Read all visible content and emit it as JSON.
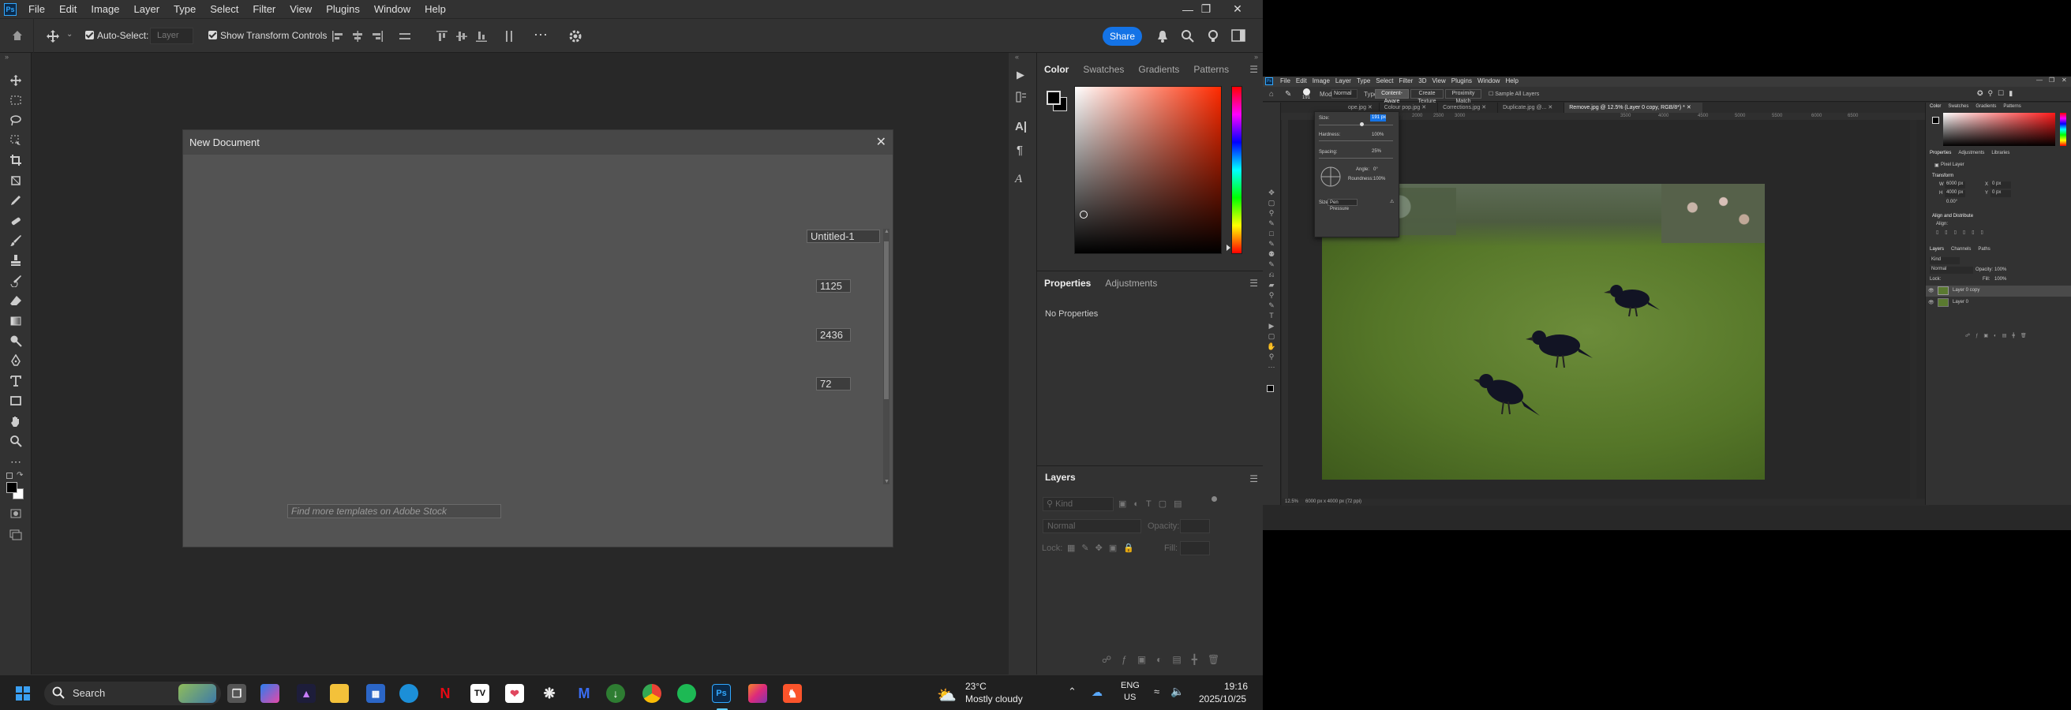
{
  "app": {
    "logo": "Ps",
    "menu": [
      "File",
      "Edit",
      "Image",
      "Layer",
      "Type",
      "Select",
      "Filter",
      "View",
      "Plugins",
      "Window",
      "Help"
    ]
  },
  "options": {
    "auto_select_label": "Auto-Select:",
    "layer_value": "Layer",
    "transform_label": "Show Transform Controls",
    "share_label": "Share"
  },
  "dialog": {
    "title": "New Document",
    "name_value": "Untitled-1",
    "width_value": "1125",
    "height_value": "2436",
    "resolution_value": "72",
    "search_placeholder": "Find more templates on Adobe Stock"
  },
  "panels": {
    "color_tabs": [
      "Color",
      "Swatches",
      "Gradients",
      "Patterns"
    ],
    "properties_tabs": [
      "Properties",
      "Adjustments"
    ],
    "no_properties": "No Properties",
    "layers_title": "Layers",
    "kind_label": "Kind",
    "blend_mode": "Normal",
    "opacity_label": "Opacity:",
    "lock_label": "Lock:",
    "fill_label": "Fill:"
  },
  "taskbar": {
    "search_label": "Search",
    "weather_temp": "23°C",
    "weather_desc": "Mostly cloudy",
    "lang1": "ENG",
    "lang2": "US",
    "time": "19:16",
    "date": "2025/10/25"
  },
  "ps2": {
    "menu": [
      "File",
      "Edit",
      "Image",
      "Layer",
      "Type",
      "Select",
      "Filter",
      "3D",
      "View",
      "Plugins",
      "Window",
      "Help"
    ],
    "mode_label": "Mode:",
    "mode_value": "Normal",
    "type_label": "Type:",
    "type_buttons": [
      "Content-Aware",
      "Create Texture",
      "Proximity Match"
    ],
    "sample_label": "Sample All Layers",
    "brush_size_value": "191",
    "brush_panel": {
      "size_label": "Size:",
      "size_value": "191 px",
      "hardness_label": "Hardness:",
      "hardness_value": "100%",
      "spacing_label": "Spacing:",
      "spacing_value": "25%",
      "angle_label": "Angle:",
      "angle_value": "0°",
      "roundness_label": "Roundness:",
      "roundness_value": "100%",
      "pen_label": "Size:",
      "pen_value": "Pen Pressure"
    },
    "tabs": [
      "ope.jpg",
      "Colour pop.jpg",
      "Corrections.jpg",
      "Duplicate.jpg @...",
      "Remove.jpg @ 12.5% (Layer 0 copy, RGB/8*) *"
    ],
    "ruler": [
      "1500",
      "1000",
      "1500",
      "2000",
      "2500",
      "3000",
      "3500",
      "4000",
      "4500",
      "5000",
      "5500",
      "6000",
      "6500"
    ],
    "status_zoom": "12.5%",
    "status_dims": "6000 px x 4000 px (72 ppi)",
    "color_tabs": [
      "Color",
      "Swatches",
      "Gradients",
      "Patterns"
    ],
    "props_tabs": [
      "Properties",
      "Adjustments",
      "Libraries"
    ],
    "pixel_layer": "Pixel Layer",
    "transform_label": "Transform",
    "w_label": "W",
    "w_value": "6000 px",
    "h_label": "H",
    "h_value": "4000 px",
    "x_label": "X",
    "x_value": "0 px",
    "y_label": "Y",
    "y_value": "0 px",
    "angle_value": "0.00°",
    "align_label": "Align and Distribute",
    "align_sub": "Align:",
    "layers_tabs": [
      "Layers",
      "Channels",
      "Paths"
    ],
    "kind_label": "Kind",
    "blend_value": "Normal",
    "opacity_label": "Opacity:",
    "opacity_value": "100%",
    "lock_label": "Lock:",
    "fill_label": "Fill:",
    "fill_value": "100%",
    "layers": [
      "Layer 0 copy",
      "Layer 0"
    ]
  },
  "colors": {
    "accent": "#1473e6",
    "panel": "#323232",
    "canvas": "#282828",
    "dialog": "#535353"
  }
}
